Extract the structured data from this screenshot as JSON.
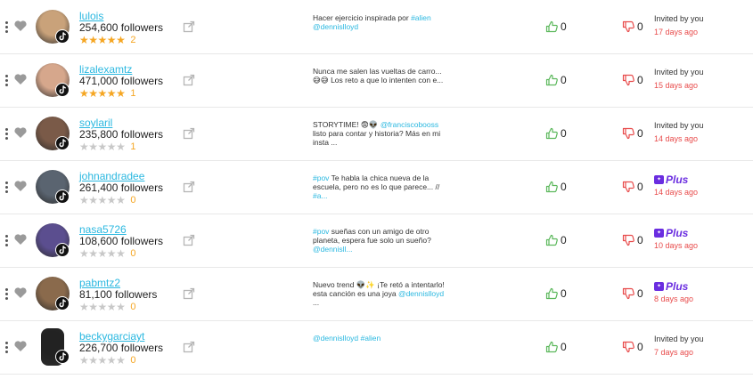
{
  "rows": [
    {
      "username": "lulois",
      "followers": "254,600 followers",
      "stars": 5,
      "rating_count": "2",
      "description": [
        {
          "t": "Hacer ejercicio inspirada por "
        },
        {
          "t": "#alien",
          "tag": true
        },
        {
          "t": " "
        },
        {
          "t": "@dennislloyd",
          "tag": true
        }
      ],
      "likes": "0",
      "dislikes": "0",
      "status": "invited",
      "invited_label": "Invited by you",
      "ago": "17 days ago",
      "avatar_color": "#c9a27a",
      "avatar_shape": "circle"
    },
    {
      "username": "lizalexamtz",
      "followers": "471,000 followers",
      "stars": 5,
      "rating_count": "1",
      "description": [
        {
          "t": "Nunca me salen las vueltas de carro... 😅😅 Los reto a que lo intenten con e..."
        }
      ],
      "likes": "0",
      "dislikes": "0",
      "status": "invited",
      "invited_label": "Invited by you",
      "ago": "15 days ago",
      "avatar_color": "#d6a78c",
      "avatar_shape": "circle"
    },
    {
      "username": "soylaril",
      "followers": "235,800 followers",
      "stars": 0,
      "rating_count": "1",
      "description": [
        {
          "t": "STORYTIME! 😨👽 "
        },
        {
          "t": "@franciscobooss",
          "tag": true
        },
        {
          "t": " listo para contar y historia? Más en mi insta ..."
        }
      ],
      "likes": "0",
      "dislikes": "0",
      "status": "invited",
      "invited_label": "Invited by you",
      "ago": "14 days ago",
      "avatar_color": "#7a5a48",
      "avatar_shape": "circle"
    },
    {
      "username": "johnandradee",
      "followers": "261,400 followers",
      "stars": 0,
      "rating_count": "0",
      "description": [
        {
          "t": "#pov",
          "tag": true
        },
        {
          "t": " Te habla la chica nueva de la escuela, pero no es lo que parece... // "
        },
        {
          "t": "#a...",
          "tag": true
        }
      ],
      "likes": "0",
      "dislikes": "0",
      "status": "plus",
      "plus_label": "Plus",
      "ago": "14 days ago",
      "avatar_color": "#5a6470",
      "avatar_shape": "circle"
    },
    {
      "username": "nasa5726",
      "followers": "108,600 followers",
      "stars": 0,
      "rating_count": "0",
      "description": [
        {
          "t": "#pov",
          "tag": true
        },
        {
          "t": " sueñas con un amigo de otro planeta, espera fue solo un sueño? "
        },
        {
          "t": "@dennisll...",
          "tag": true
        }
      ],
      "likes": "0",
      "dislikes": "0",
      "status": "plus",
      "plus_label": "Plus",
      "ago": "10 days ago",
      "avatar_color": "#5b4e8f",
      "avatar_shape": "circle"
    },
    {
      "username": "pabmtz2",
      "followers": "81,100 followers",
      "stars": 0,
      "rating_count": "0",
      "description": [
        {
          "t": "Nuevo trend 👽✨ ¡Te retó a intentarlo! esta canción es una joya "
        },
        {
          "t": "@dennislloyd",
          "tag": true
        },
        {
          "t": " ..."
        }
      ],
      "likes": "0",
      "dislikes": "0",
      "status": "plus",
      "plus_label": "Plus",
      "ago": "8 days ago",
      "avatar_color": "#8a6a4c",
      "avatar_shape": "circle"
    },
    {
      "username": "beckygarciayt",
      "followers": "226,700 followers",
      "stars": 0,
      "rating_count": "0",
      "description": [
        {
          "t": "@dennislloyd #alien",
          "tag": true
        }
      ],
      "likes": "0",
      "dislikes": "0",
      "status": "invited",
      "invited_label": "Invited by you",
      "ago": "7 days ago",
      "avatar_color": "#222222",
      "avatar_shape": "rect"
    }
  ],
  "icons": {
    "menu": "kebab-icon",
    "favorite": "heart-icon",
    "link": "external-link-icon",
    "like": "thumbs-up-icon",
    "dislike": "thumbs-down-icon",
    "platform": "tiktok-icon",
    "plus_logo": "plus-logo-icon"
  },
  "colors": {
    "username": "#2bb8e0",
    "star_on": "#f5a623",
    "star_off": "#c8c8c8",
    "like": "#5cb85c",
    "dislike": "#e84b4b",
    "ago": "#e84b4b",
    "plus": "#6a2de0"
  }
}
